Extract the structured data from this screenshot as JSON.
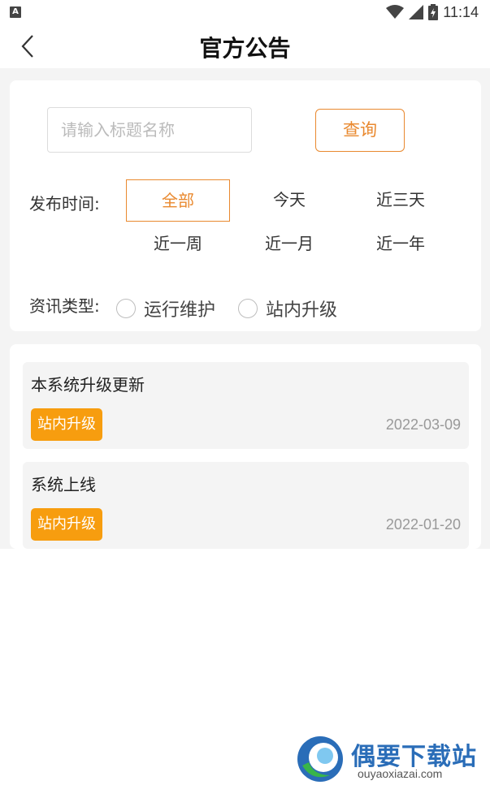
{
  "status_bar": {
    "time": "11:14"
  },
  "header": {
    "title": "官方公告"
  },
  "search": {
    "placeholder": "请输入标题名称",
    "button_label": "查询"
  },
  "filters": {
    "time_label": "发布时间:",
    "time_options": [
      "全部",
      "今天",
      "近三天",
      "近一周",
      "近一月",
      "近一年"
    ],
    "selected_time": "全部",
    "type_label": "资讯类型:",
    "type_options": [
      "运行维护",
      "站内升级"
    ]
  },
  "announcements": [
    {
      "title": "本系统升级更新",
      "tag": "站内升级",
      "date": "2022-03-09"
    },
    {
      "title": "系统上线",
      "tag": "站内升级",
      "date": "2022-01-20"
    }
  ],
  "watermark": {
    "name": "偶要下载站",
    "url": "ouyaoxiazai.com"
  },
  "colors": {
    "accent": "#e9892f",
    "tag_bg": "#f79d0f",
    "brand_blue": "#2a6db8"
  }
}
